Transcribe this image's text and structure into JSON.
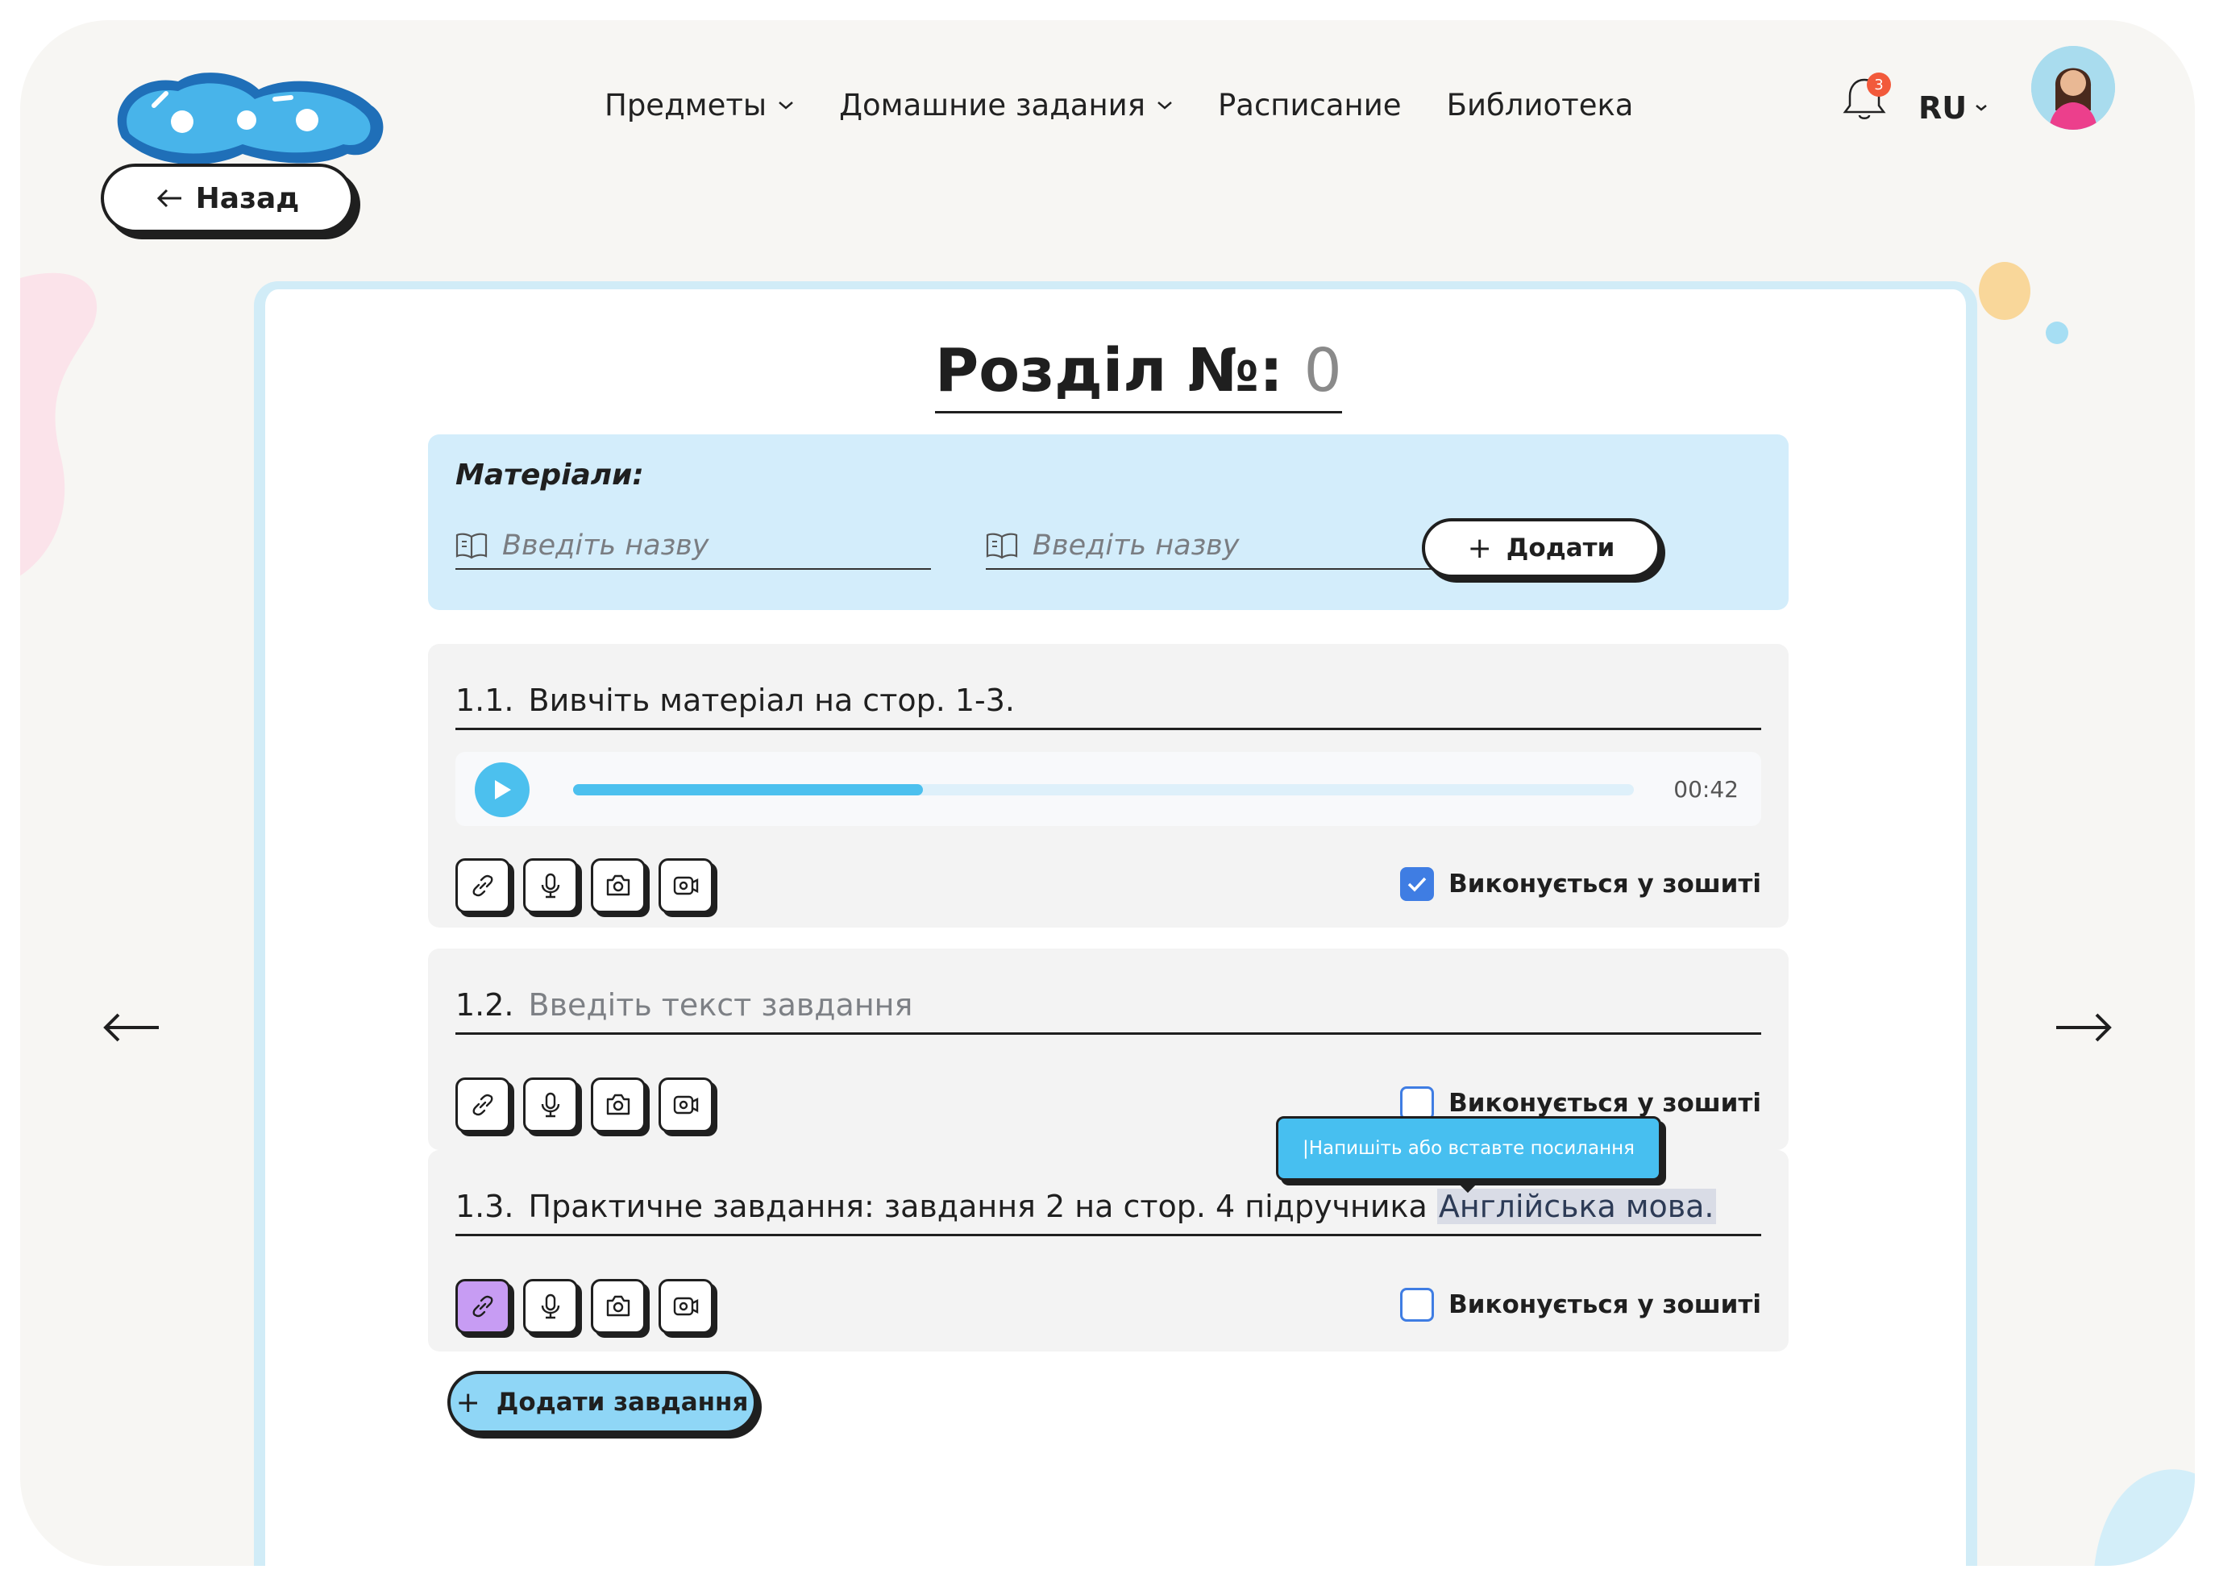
{
  "header": {
    "nav": [
      {
        "label": "Предметы",
        "dropdown": true
      },
      {
        "label": "Домашние задания",
        "dropdown": true
      },
      {
        "label": "Расписание",
        "dropdown": false
      },
      {
        "label": "Библиотека",
        "dropdown": false
      }
    ],
    "notifications_count": "3",
    "language": "RU"
  },
  "back_label": "Назад",
  "section": {
    "label": "Розділ №:",
    "number": "0"
  },
  "materials": {
    "label": "Матеріали:",
    "inputs": [
      {
        "placeholder": "Введіть назву"
      },
      {
        "placeholder": "Введіть назву"
      }
    ],
    "add_label": "Додати"
  },
  "tasks": [
    {
      "number": "1.1.",
      "text": "Вивчіть матеріал на стор. 1-3.",
      "audio": {
        "time": "00:42",
        "progress": 0.33
      },
      "notebook_label": "Виконується у зошиті",
      "notebook_checked": true
    },
    {
      "number": "1.2.",
      "placeholder": "Введіть текст завдання",
      "notebook_label": "Виконується у зошиті",
      "notebook_checked": false
    },
    {
      "number": "1.3.",
      "text": "Практичне завдання: завдання 2 на стор. 4 підручника ",
      "highlight": "Англійська мова.",
      "notebook_label": "Виконується у зошиті",
      "notebook_checked": false
    }
  ],
  "tooltip": "|Напишіть або вставте посилання",
  "add_task_label": "Додати завдання",
  "colors": {
    "accent": "#4cc0ee",
    "checkbox": "#3f7de3",
    "materials_bg": "#d3edfb",
    "active_tool": "#c79cf3"
  }
}
